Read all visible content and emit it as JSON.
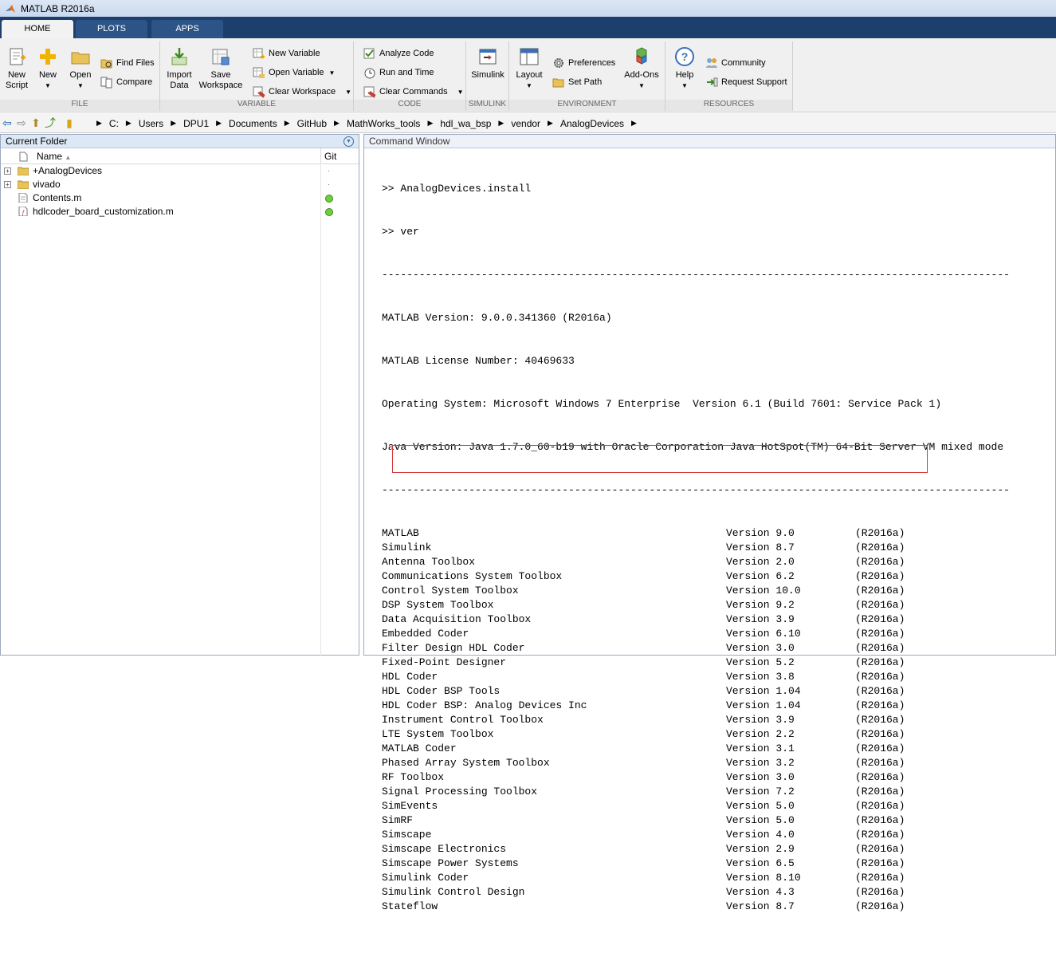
{
  "window": {
    "title": "MATLAB R2016a"
  },
  "tabs": [
    {
      "label": "HOME"
    },
    {
      "label": "PLOTS"
    },
    {
      "label": "APPS"
    }
  ],
  "ribbon": {
    "file": {
      "label": "FILE",
      "new_script": "New\nScript",
      "new": "New",
      "open": "Open",
      "find_files": "Find Files",
      "compare": "Compare"
    },
    "variable": {
      "label": "VARIABLE",
      "import_data": "Import\nData",
      "save_workspace": "Save\nWorkspace",
      "new_variable": "New Variable",
      "open_variable": "Open Variable",
      "clear_workspace": "Clear Workspace"
    },
    "code": {
      "label": "CODE",
      "analyze_code": "Analyze Code",
      "run_and_time": "Run and Time",
      "clear_commands": "Clear Commands"
    },
    "simulink": {
      "label": "SIMULINK",
      "simulink": "Simulink"
    },
    "environment": {
      "label": "ENVIRONMENT",
      "layout": "Layout",
      "preferences": "Preferences",
      "set_path": "Set Path",
      "add_ons": "Add-Ons"
    },
    "resources": {
      "label": "RESOURCES",
      "help": "Help",
      "community": "Community",
      "request_support": "Request Support"
    }
  },
  "address": {
    "crumbs": [
      "C:",
      "Users",
      "DPU1",
      "Documents",
      "GitHub",
      "MathWorks_tools",
      "hdl_wa_bsp",
      "vendor",
      "AnalogDevices"
    ]
  },
  "current_folder": {
    "title": "Current Folder",
    "col_name": "Name",
    "col_git": "Git",
    "items": [
      {
        "name": "+AnalogDevices",
        "type": "folder"
      },
      {
        "name": "vivado",
        "type": "folder"
      },
      {
        "name": "Contents.m",
        "type": "file"
      },
      {
        "name": "hdlcoder_board_customization.m",
        "type": "mfunc"
      }
    ]
  },
  "command_window": {
    "title": "Command Window",
    "lines": [
      ">> AnalogDevices.install",
      ">> ver",
      "-----------------------------------------------------------------------------------------------------",
      "MATLAB Version: 9.0.0.341360 (R2016a)",
      "MATLAB License Number: 40469633",
      "Operating System: Microsoft Windows 7 Enterprise  Version 6.1 (Build 7601: Service Pack 1)",
      "Java Version: Java 1.7.0_60-b19 with Oracle Corporation Java HotSpot(TM) 64-Bit Server VM mixed mode",
      "-----------------------------------------------------------------------------------------------------"
    ],
    "products": [
      {
        "name": "MATLAB",
        "version": "Version 9.0",
        "release": "(R2016a)"
      },
      {
        "name": "Simulink",
        "version": "Version 8.7",
        "release": "(R2016a)"
      },
      {
        "name": "Antenna Toolbox",
        "version": "Version 2.0",
        "release": "(R2016a)"
      },
      {
        "name": "Communications System Toolbox",
        "version": "Version 6.2",
        "release": "(R2016a)"
      },
      {
        "name": "Control System Toolbox",
        "version": "Version 10.0",
        "release": "(R2016a)"
      },
      {
        "name": "DSP System Toolbox",
        "version": "Version 9.2",
        "release": "(R2016a)"
      },
      {
        "name": "Data Acquisition Toolbox",
        "version": "Version 3.9",
        "release": "(R2016a)"
      },
      {
        "name": "Embedded Coder",
        "version": "Version 6.10",
        "release": "(R2016a)"
      },
      {
        "name": "Filter Design HDL Coder",
        "version": "Version 3.0",
        "release": "(R2016a)"
      },
      {
        "name": "Fixed-Point Designer",
        "version": "Version 5.2",
        "release": "(R2016a)"
      },
      {
        "name": "HDL Coder",
        "version": "Version 3.8",
        "release": "(R2016a)"
      },
      {
        "name": "HDL Coder BSP Tools",
        "version": "Version 1.04",
        "release": "(R2016a)"
      },
      {
        "name": "HDL Coder BSP: Analog Devices Inc",
        "version": "Version 1.04",
        "release": "(R2016a)"
      },
      {
        "name": "Instrument Control Toolbox",
        "version": "Version 3.9",
        "release": "(R2016a)"
      },
      {
        "name": "LTE System Toolbox",
        "version": "Version 2.2",
        "release": "(R2016a)"
      },
      {
        "name": "MATLAB Coder",
        "version": "Version 3.1",
        "release": "(R2016a)"
      },
      {
        "name": "Phased Array System Toolbox",
        "version": "Version 3.2",
        "release": "(R2016a)"
      },
      {
        "name": "RF Toolbox",
        "version": "Version 3.0",
        "release": "(R2016a)"
      },
      {
        "name": "Signal Processing Toolbox",
        "version": "Version 7.2",
        "release": "(R2016a)"
      },
      {
        "name": "SimEvents",
        "version": "Version 5.0",
        "release": "(R2016a)"
      },
      {
        "name": "SimRF",
        "version": "Version 5.0",
        "release": "(R2016a)"
      },
      {
        "name": "Simscape",
        "version": "Version 4.0",
        "release": "(R2016a)"
      },
      {
        "name": "Simscape Electronics",
        "version": "Version 2.9",
        "release": "(R2016a)"
      },
      {
        "name": "Simscape Power Systems",
        "version": "Version 6.5",
        "release": "(R2016a)"
      },
      {
        "name": "Simulink Coder",
        "version": "Version 8.10",
        "release": "(R2016a)"
      },
      {
        "name": "Simulink Control Design",
        "version": "Version 4.3",
        "release": "(R2016a)"
      },
      {
        "name": "Stateflow",
        "version": "Version 8.7",
        "release": "(R2016a)"
      }
    ]
  }
}
